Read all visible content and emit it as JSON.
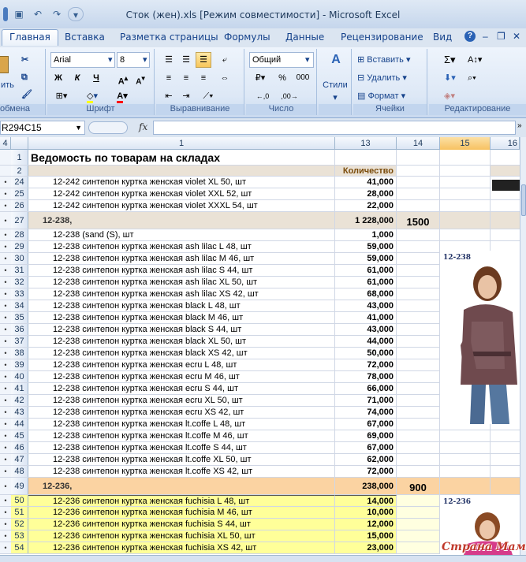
{
  "window": {
    "title": "Сток (жен).xls  [Режим совместимости] - Microsoft Excel"
  },
  "tabs": [
    "Главная",
    "Вставка",
    "Разметка страницы",
    "Формулы",
    "Данные",
    "Рецензирование",
    "Вид"
  ],
  "ribbon": {
    "clipboard": {
      "label": "обмена",
      "paste_fragment": "ить"
    },
    "font": {
      "label": "Шрифт",
      "name": "Arial",
      "size": "8",
      "bold": "Ж",
      "italic": "К",
      "underline": "Ч"
    },
    "alignment": {
      "label": "Выравнивание"
    },
    "number": {
      "label": "Число",
      "format": "Общий",
      "percent": "%",
      "thousands": "000"
    },
    "styles": {
      "label": "Стили"
    },
    "cells": {
      "label": "Ячейки",
      "insert": "Вставить",
      "delete": "Удалить",
      "format": "Формат"
    },
    "editing": {
      "label": "Редактирование"
    }
  },
  "formula_bar": {
    "name_box": "R294C15",
    "fx": "fx",
    "value": ""
  },
  "columns": [
    "4",
    "1",
    "13",
    "14",
    "15",
    "16"
  ],
  "sheet": {
    "title": "Ведомость по товарам на складах",
    "qty_header": "Количество",
    "rows": [
      {
        "n": "24",
        "text": "12-242 синтепон куртка женская violet XL 50, шт",
        "qty": "41,000",
        "kind": "item"
      },
      {
        "n": "25",
        "text": "12-242 синтепон куртка женская violet XXL 52, шт",
        "qty": "28,000",
        "kind": "item"
      },
      {
        "n": "26",
        "text": "12-242 синтепон куртка женская violet XXXL 54, шт",
        "qty": "22,000",
        "kind": "item"
      },
      {
        "n": "27",
        "text": "12-238,",
        "qty": "1 228,000",
        "extra": "1500",
        "kind": "grp"
      },
      {
        "n": "28",
        "text": "12-238 (sand (S), шт",
        "qty": "1,000",
        "kind": "item"
      },
      {
        "n": "29",
        "text": "12-238 синтепон куртка женская ash lilac  L 48, шт",
        "qty": "59,000",
        "kind": "item"
      },
      {
        "n": "30",
        "text": "12-238 синтепон куртка женская ash lilac  M 46, шт",
        "qty": "59,000",
        "kind": "item"
      },
      {
        "n": "31",
        "text": "12-238 синтепон куртка женская ash lilac  S 44, шт",
        "qty": "61,000",
        "kind": "item"
      },
      {
        "n": "32",
        "text": "12-238 синтепон куртка женская ash lilac  XL 50, шт",
        "qty": "61,000",
        "kind": "item"
      },
      {
        "n": "33",
        "text": "12-238 синтепон куртка женская ash lilac  XS 42, шт",
        "qty": "68,000",
        "kind": "item"
      },
      {
        "n": "34",
        "text": "12-238 синтепон куртка женская black  L 48, шт",
        "qty": "43,000",
        "kind": "item"
      },
      {
        "n": "35",
        "text": "12-238 синтепон куртка женская black  M 46, шт",
        "qty": "41,000",
        "kind": "item"
      },
      {
        "n": "36",
        "text": "12-238 синтепон куртка женская black  S 44, шт",
        "qty": "43,000",
        "kind": "item"
      },
      {
        "n": "37",
        "text": "12-238 синтепон куртка женская black  XL 50, шт",
        "qty": "44,000",
        "kind": "item"
      },
      {
        "n": "38",
        "text": "12-238 синтепон куртка женская black  XS 42, шт",
        "qty": "50,000",
        "kind": "item"
      },
      {
        "n": "39",
        "text": "12-238 синтепон куртка женская ecru  L 48, шт",
        "qty": "72,000",
        "kind": "item"
      },
      {
        "n": "40",
        "text": "12-238 синтепон куртка женская ecru  M 46, шт",
        "qty": "78,000",
        "kind": "item"
      },
      {
        "n": "41",
        "text": "12-238 синтепон куртка женская ecru  S 44, шт",
        "qty": "66,000",
        "kind": "item"
      },
      {
        "n": "42",
        "text": "12-238 синтепон куртка женская ecru  XL 50, шт",
        "qty": "71,000",
        "kind": "item"
      },
      {
        "n": "43",
        "text": "12-238 синтепон куртка женская ecru  XS 42, шт",
        "qty": "74,000",
        "kind": "item"
      },
      {
        "n": "44",
        "text": "12-238 синтепон куртка женская lt.coffe  L 48, шт",
        "qty": "67,000",
        "kind": "item"
      },
      {
        "n": "45",
        "text": "12-238 синтепон куртка женская lt.coffe  M 46, шт",
        "qty": "69,000",
        "kind": "item"
      },
      {
        "n": "46",
        "text": "12-238 синтепон куртка женская lt.coffe  S 44, шт",
        "qty": "67,000",
        "kind": "item"
      },
      {
        "n": "47",
        "text": "12-238 синтепон куртка женская lt.coffe  XL 50, шт",
        "qty": "62,000",
        "kind": "item"
      },
      {
        "n": "48",
        "text": "12-238 синтепон куртка женская lt.coffe  XS 42, шт",
        "qty": "72,000",
        "kind": "item"
      },
      {
        "n": "49",
        "text": "12-236,",
        "qty": "238,000",
        "extra": "900",
        "kind": "grp2"
      },
      {
        "n": "50",
        "text": "12-236 синтепон куртка женская fuchisia  L 48, шт",
        "qty": "14,000",
        "kind": "yel"
      },
      {
        "n": "51",
        "text": "12-236 синтепон куртка женская fuchisia  M 46, шт",
        "qty": "10,000",
        "kind": "yel"
      },
      {
        "n": "52",
        "text": "12-236 синтепон куртка женская fuchisia  S 44, шт",
        "qty": "12,000",
        "kind": "yel"
      },
      {
        "n": "53",
        "text": "12-236 синтепон куртка женская fuchisia  XL 50, шт",
        "qty": "15,000",
        "kind": "yel"
      },
      {
        "n": "54",
        "text": "12-236 синтепон куртка женская fuchisia  XS 42, шт",
        "qty": "23,000",
        "kind": "yel"
      }
    ]
  },
  "photos": {
    "first_caption": "12-238",
    "second_caption": "12-236"
  },
  "watermark": "Страна Мам"
}
